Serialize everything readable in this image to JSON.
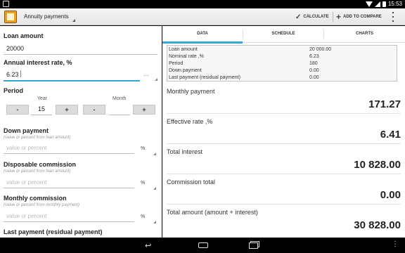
{
  "status": {
    "time": "15:53"
  },
  "app": {
    "title": "Annuity payments",
    "calculate_label": "CALCULATE",
    "add_compare_label": "ADD TO COMPARE"
  },
  "form": {
    "loan_amount": {
      "label": "Loan amount",
      "value": "20000"
    },
    "interest": {
      "label": "Annual interest rate, %",
      "value": "6.23",
      "more": "···"
    },
    "period": {
      "label": "Period",
      "year_label": "Year",
      "year_value": "15",
      "month_label": "Month",
      "month_value": "",
      "minus": "-",
      "plus": "+"
    },
    "down_payment": {
      "label": "Down payment",
      "hint": "(value or percent from loan amount)",
      "placeholder": "value or percent",
      "unit": "%"
    },
    "disposable_commission": {
      "label": "Disposable commission",
      "hint": "(value or percent from loan amount)",
      "placeholder": "value or percent",
      "unit": "%"
    },
    "monthly_commission": {
      "label": "Monthly commission",
      "hint": "(value or percent from monthly payment)",
      "placeholder": "value or percent",
      "unit": "%"
    },
    "last_payment": {
      "label": "Last payment (residual payment)"
    }
  },
  "tabs": [
    "DATA",
    "SCHEDULE",
    "CHARTS"
  ],
  "summary": {
    "rows": [
      {
        "label": "Loan amount",
        "value": "20 000.00"
      },
      {
        "label": "Nominal rate ,%",
        "value": "6.23"
      },
      {
        "label": "Period",
        "value": "180"
      },
      {
        "label": "Down payment",
        "value": "0.00"
      },
      {
        "label": "Last payment (residual payment)",
        "value": "0.00"
      }
    ]
  },
  "results": [
    {
      "label": "Monthly payment",
      "value": "171.27"
    },
    {
      "label": "Effective rate ,%",
      "value": "6.41"
    },
    {
      "label": "Total interest",
      "value": "10 828.00"
    },
    {
      "label": "Commission total",
      "value": "0.00"
    },
    {
      "label": "Total amount (amount + interest)",
      "value": "30 828.00"
    }
  ],
  "colors": {
    "accent": "#35a7d7",
    "app_icon": "#e9a21f"
  },
  "icons": [
    "wifi-icon",
    "signal-icon",
    "battery-icon",
    "check-icon",
    "plus-icon",
    "overflow-menu-icon",
    "back-icon",
    "home-icon",
    "recents-icon",
    "menu-icon"
  ]
}
